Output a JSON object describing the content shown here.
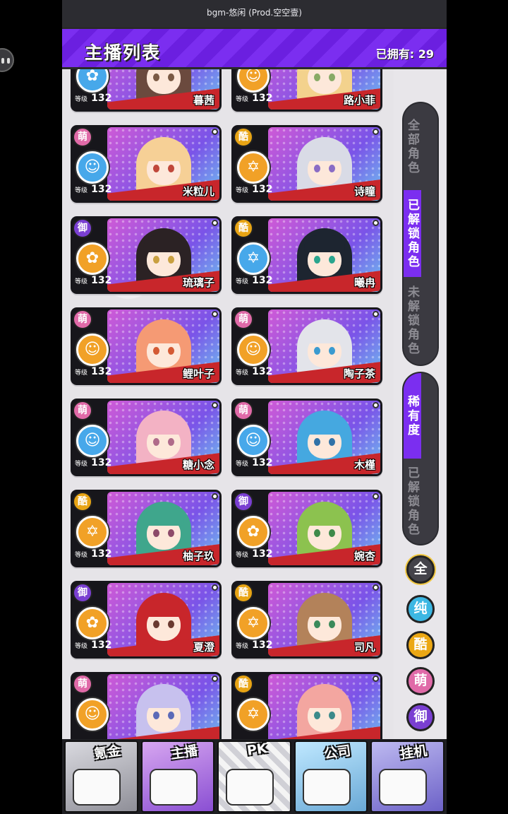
{
  "bgm": "bgm-悠闲 (Prod.空空壹)",
  "header": {
    "title": "主播列表",
    "owned": "已拥有: 29"
  },
  "level_label": "等级",
  "cards": [
    {
      "name": "暮茜",
      "tag": "",
      "level": "132",
      "hair": "#6b4a3e",
      "eye": "#7a5a44",
      "medal": "rose",
      "medal_color": "blue"
    },
    {
      "name": "路小菲",
      "tag": "",
      "level": "132",
      "hair": "#f3d28d",
      "eye": "#8a6",
      "medal": "cat",
      "medal_color": "orange"
    },
    {
      "name": "米粒儿",
      "tag": "萌",
      "level": "132",
      "hair": "#f6d096",
      "eye": "#c0473a",
      "medal": "cat",
      "medal_color": "blue"
    },
    {
      "name": "诗瞳",
      "tag": "酷",
      "level": "132",
      "hair": "#d9dbe6",
      "eye": "#8a6cc5",
      "medal": "star",
      "medal_color": "orange"
    },
    {
      "name": "琉璃子",
      "tag": "御",
      "level": "132",
      "hair": "#2b2224",
      "eye": "#c9a040",
      "medal": "rose",
      "medal_color": "orange"
    },
    {
      "name": "曦冉",
      "tag": "酷",
      "level": "132",
      "hair": "#1d2530",
      "eye": "#2aa58e",
      "medal": "star",
      "medal_color": "blue"
    },
    {
      "name": "鲤叶子",
      "tag": "萌",
      "level": "132",
      "hair": "#f59a74",
      "eye": "#d45a34",
      "medal": "cat",
      "medal_color": "orange"
    },
    {
      "name": "陶子茶",
      "tag": "萌",
      "level": "132",
      "hair": "#e3e4ea",
      "eye": "#3b9bd0",
      "medal": "cat",
      "medal_color": "orange"
    },
    {
      "name": "糖小念",
      "tag": "萌",
      "level": "132",
      "hair": "#f3b2c4",
      "eye": "#b06a8a",
      "medal": "cat",
      "medal_color": "blue"
    },
    {
      "name": "木槿",
      "tag": "萌",
      "level": "132",
      "hair": "#45a8e0",
      "eye": "#3072a8",
      "medal": "cat",
      "medal_color": "blue"
    },
    {
      "name": "柚子玖",
      "tag": "酷",
      "level": "132",
      "hair": "#3fa68c",
      "eye": "#8d4a6a",
      "medal": "star",
      "medal_color": "orange"
    },
    {
      "name": "婉杏",
      "tag": "御",
      "level": "132",
      "hair": "#8cc24f",
      "eye": "#3f8a4a",
      "medal": "rose",
      "medal_color": "orange"
    },
    {
      "name": "夏澄",
      "tag": "御",
      "level": "132",
      "hair": "#c8262b",
      "eye": "#6a3a30",
      "medal": "rose",
      "medal_color": "orange"
    },
    {
      "name": "司凡",
      "tag": "酷",
      "level": "132",
      "hair": "#b3825a",
      "eye": "#3b8a5a",
      "medal": "star",
      "medal_color": "orange"
    },
    {
      "name": "",
      "tag": "萌",
      "level": "",
      "hair": "#c7c1ee",
      "eye": "#5b6ab8",
      "medal": "cat",
      "medal_color": "orange"
    },
    {
      "name": "",
      "tag": "酷",
      "level": "",
      "hair": "#f3a6a0",
      "eye": "#3b8a8a",
      "medal": "star",
      "medal_color": "orange"
    }
  ],
  "tabs_group1": [
    "全部角色",
    "已解锁角色",
    "未解锁角色"
  ],
  "tabs_group2": [
    "稀有度",
    "已解锁角色"
  ],
  "filters": [
    "全",
    "纯",
    "酷",
    "萌",
    "御"
  ],
  "nav": [
    "氪金",
    "主播",
    "PK",
    "公司",
    "挂机"
  ]
}
